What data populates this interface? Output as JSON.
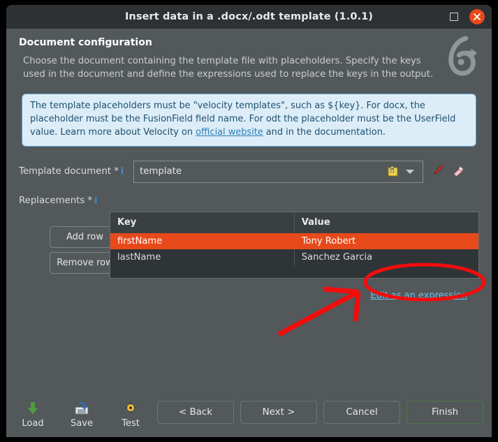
{
  "window": {
    "title": "Insert data in a .docx/.odt template (1.0.1)",
    "maximize_label": "maximize-button",
    "close_label": "close-button"
  },
  "header": {
    "title": "Document configuration",
    "description": "Choose the document containing the template file with placeholders. Specify the keys used in the document and define the expressions used to replace the keys in the output.",
    "logo_name": "brand-logo"
  },
  "info_banner": {
    "text_before_link": "The template placeholders must be \"velocity templates\", such as ${key}. For docx, the placeholder must be the FusionField field name. For odt the placeholder must be the UserField value. Learn more about Velocity on ",
    "link_text": "official website",
    "text_after_link": " and in the documentation."
  },
  "form": {
    "template_document": {
      "label": "Template document *",
      "info_marker": "i",
      "value": "template",
      "placeholder": "",
      "note_icon": "note-icon",
      "dropdown_icon": "chevron-down-icon",
      "pen_icon": "pen-icon",
      "eraser_icon": "eraser-icon"
    },
    "replacements": {
      "label": "Replacements *",
      "info_marker": "i",
      "add_row_label": "Add row",
      "remove_row_label": "Remove row",
      "edit_expression_label": "Edit as an expression",
      "columns": [
        "Key",
        "Value"
      ],
      "rows": [
        {
          "key": "firstName",
          "value": "Tony Robert",
          "selected": true
        },
        {
          "key": "lastName",
          "value": "Sanchez Garcia",
          "selected": false
        }
      ]
    }
  },
  "footer": {
    "tools": [
      {
        "label": "Load",
        "icon": "download-arrow-icon"
      },
      {
        "label": "Save",
        "icon": "save-disk-icon"
      },
      {
        "label": "Test",
        "icon": "test-compass-icon"
      }
    ],
    "buttons": [
      {
        "label": "< Back",
        "name": "back-button",
        "primary": false
      },
      {
        "label": "Next >",
        "name": "next-button",
        "primary": false
      },
      {
        "label": "Cancel",
        "name": "cancel-button",
        "primary": false
      },
      {
        "label": "Finish",
        "name": "finish-button",
        "primary": true
      }
    ]
  },
  "annotation": {
    "ellipse_color": "#f20d0d",
    "arrow_color": "#f20d0d"
  },
  "colors": {
    "window_bg": "#53585a",
    "titlebar_bg": "#2e3134",
    "accent_selected_row": "#e8491a",
    "info_banner_bg": "#dcedf8",
    "info_banner_border": "#5c9fd3",
    "link": "#6fc0e8",
    "table_bg": "#2f3437"
  }
}
